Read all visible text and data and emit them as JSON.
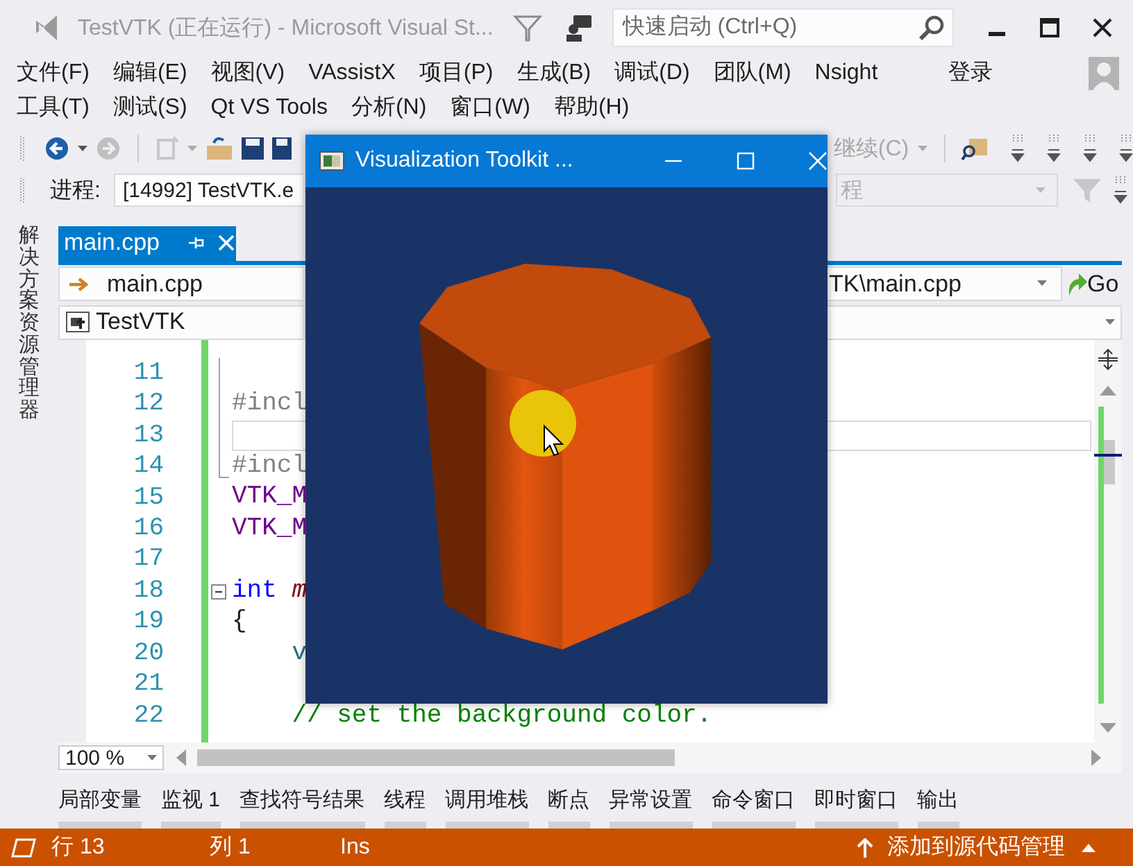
{
  "window": {
    "title": "TestVTK (正在运行) - Microsoft Visual St...",
    "quick_launch": {
      "placeholder": "快速启动 (Ctrl+Q)"
    },
    "sign_in": "登录"
  },
  "menu_rows": [
    {
      "items": [
        "文件(F)",
        "编辑(E)",
        "视图(V)",
        "VAssistX",
        "项目(P)",
        "生成(B)",
        "调试(D)",
        "团队(M)",
        "Nsight"
      ]
    },
    {
      "items": [
        "工具(T)",
        "测试(S)",
        "Qt VS Tools",
        "分析(N)",
        "窗口(W)",
        "帮助(H)"
      ]
    }
  ],
  "toolbar": {
    "continue": {
      "label": "继续(C)",
      "disabled": true
    }
  },
  "process_bar": {
    "label": "进程:",
    "process": "[14992] TestVTK.e",
    "thread": "程"
  },
  "side_tabs": [
    {
      "label": "解决方案资源管理器"
    }
  ],
  "document_tabs": [
    {
      "label": "main.cpp",
      "selected": true
    }
  ],
  "navigation": {
    "file": "main.cpp",
    "path": "TK\\main.cpp",
    "go": "Go",
    "scope": "TestVTK"
  },
  "editor": {
    "zoom": "100 %",
    "lines": [
      {
        "number": "11",
        "current": false,
        "in_region": true,
        "collapsible": false
      },
      {
        "number": "12",
        "current": false,
        "in_region": true,
        "collapsible": false,
        "segments": [
          {
            "kind": "preprocessor",
            "text": "#incl"
          }
        ]
      },
      {
        "number": "13",
        "current": true,
        "in_region": true,
        "collapsible": false
      },
      {
        "number": "14",
        "current": false,
        "in_region": true,
        "collapsible": false,
        "segments": [
          {
            "kind": "preprocessor",
            "text": "#incl"
          }
        ]
      },
      {
        "number": "15",
        "current": false,
        "in_region": false,
        "collapsible": false,
        "segments": [
          {
            "kind": "macro",
            "text": "VTK_M"
          }
        ]
      },
      {
        "number": "16",
        "current": false,
        "in_region": false,
        "collapsible": false,
        "segments": [
          {
            "kind": "macro",
            "text": "VTK_M"
          }
        ]
      },
      {
        "number": "17",
        "current": false,
        "in_region": false,
        "collapsible": false
      },
      {
        "number": "18",
        "current": false,
        "in_region": false,
        "collapsible": true,
        "segments": [
          {
            "kind": "keyword",
            "text": "int"
          },
          {
            "kind": "function",
            "text": " m"
          }
        ]
      },
      {
        "number": "19",
        "current": false,
        "in_region": false,
        "collapsible": false,
        "segments": [
          {
            "kind": "plain",
            "text": "{"
          }
        ]
      },
      {
        "number": "20",
        "current": false,
        "in_region": false,
        "collapsible": false,
        "segments": [
          {
            "kind": "type",
            "text": "    v"
          }
        ]
      },
      {
        "number": "21",
        "current": false,
        "in_region": false,
        "collapsible": false
      },
      {
        "number": "22",
        "current": false,
        "in_region": false,
        "collapsible": false,
        "segments": [
          {
            "kind": "comment",
            "text": "    // set the background color."
          }
        ]
      }
    ]
  },
  "tool_tabs": [
    "局部变量",
    "监视 1",
    "查找符号结果",
    "线程",
    "调用堆栈",
    "断点",
    "异常设置",
    "命令窗口",
    "即时窗口",
    "输出"
  ],
  "status_bar": {
    "line": "行 13",
    "column": "列 1",
    "mode": "Ins",
    "source_control": "添加到源代码管理"
  },
  "vtk_window": {
    "title": "Visualization Toolkit ..."
  }
}
